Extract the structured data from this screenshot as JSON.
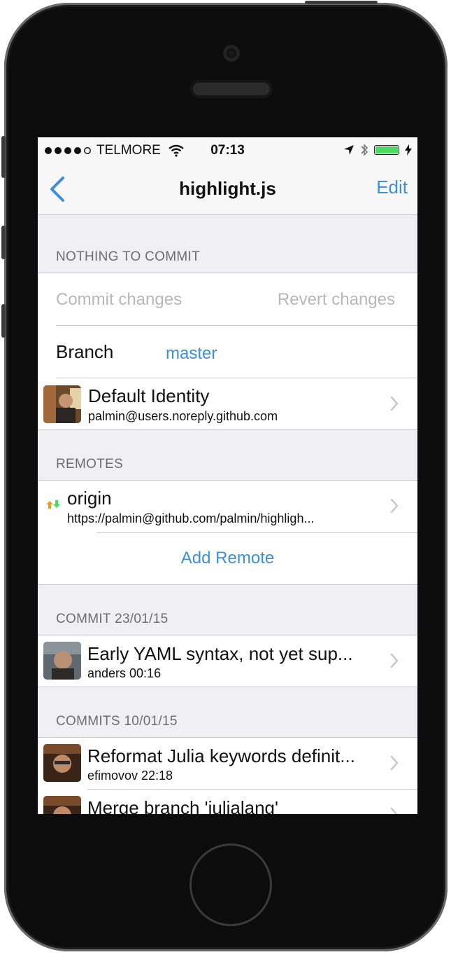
{
  "status_bar": {
    "carrier": "TELMORE",
    "time": "07:13"
  },
  "nav": {
    "title": "highlight.js",
    "edit_label": "Edit",
    "back_icon": "chevron-left-icon"
  },
  "sections": {
    "nothing_to_commit": "NOTHING TO COMMIT",
    "remotes": "REMOTES",
    "commit_date_1": "COMMIT 23/01/15",
    "commit_date_2": "COMMITS 10/01/15"
  },
  "actions": {
    "commit_changes": "Commit changes",
    "revert_changes": "Revert changes"
  },
  "branch": {
    "label": "Branch",
    "value": "master"
  },
  "identity": {
    "title": "Default Identity",
    "email": "palmin@users.noreply.github.com"
  },
  "remote": {
    "name": "origin",
    "url": "https://palmin@github.com/palmin/highligh...",
    "add_label": "Add Remote"
  },
  "commits": [
    {
      "message": "Early YAML syntax, not yet sup...",
      "meta": "anders 00:16"
    },
    {
      "message": "Reformat Julia keywords definit...",
      "meta": "efimovov 22:18"
    },
    {
      "message": "Merge branch 'julialang'",
      "meta": ""
    }
  ],
  "colors": {
    "accent": "#3c8fd9",
    "background": "#efeff4",
    "battery": "#4cd964"
  }
}
